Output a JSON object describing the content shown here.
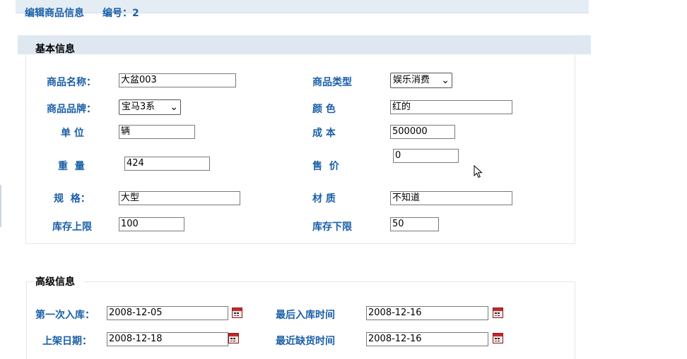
{
  "header": {
    "title": "编辑商品信息",
    "id_label": "编号：2"
  },
  "basic": {
    "section_title": "基本信息",
    "name_label": "商品名称：",
    "name_value": "大盆003",
    "type_label": "商品类型",
    "type_value": "娱乐消费",
    "brand_label": "商品品牌：",
    "brand_value": "宝马3系",
    "color_label": "颜 色",
    "color_value": "红的",
    "unit_label": "单 位",
    "unit_value": "辆",
    "cost_label": "成 本",
    "cost_value": "500000",
    "weight_label": "重  量",
    "weight_value": "424",
    "price_label": "售  价",
    "price_value": "0",
    "spec_label": "规  格：",
    "spec_value": "大型",
    "material_label": "材 质",
    "material_value": "不知道",
    "stock_max_label": "库存上限",
    "stock_max_value": "100",
    "stock_min_label": "库存下限",
    "stock_min_value": "50"
  },
  "advanced": {
    "section_title": "高级信息",
    "first_in_label": "第一次入库：",
    "first_in_value": "2008-12-05",
    "last_in_label": "最后入库时间",
    "last_in_value": "2008-12-16",
    "shelf_label": "上架日期：",
    "shelf_value": "2008-12-18",
    "shortage_label": "最近缺货时间",
    "shortage_value": "2008-12-16"
  },
  "icons": {
    "calendar": "calendar-icon",
    "cursor": "mouse-cursor-icon"
  },
  "colors": {
    "label_blue": "#1a5fa8",
    "header_bg": "#e4ecf4",
    "section_bg": "#dfe8f1"
  }
}
